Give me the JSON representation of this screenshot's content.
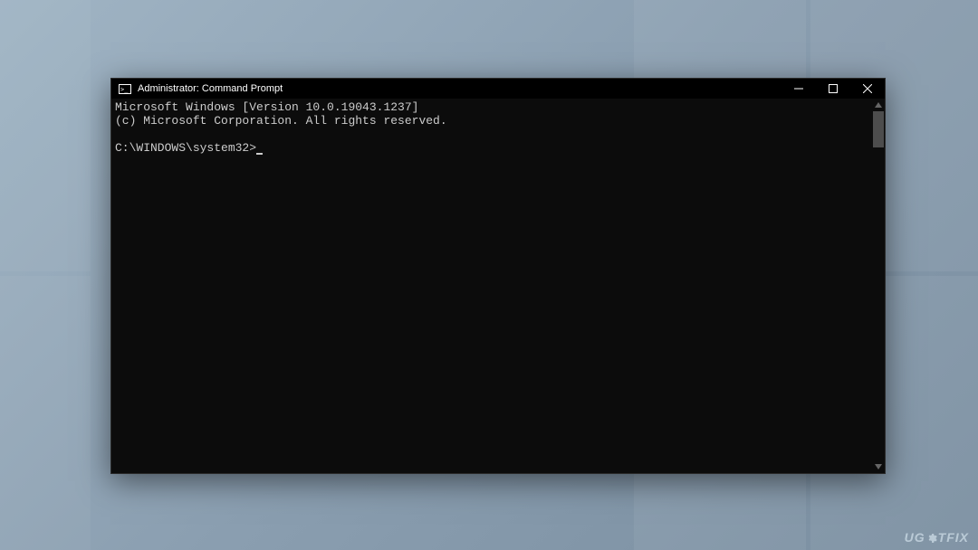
{
  "window": {
    "title": "Administrator: Command Prompt"
  },
  "terminal": {
    "line1": "Microsoft Windows [Version 10.0.19043.1237]",
    "line2": "(c) Microsoft Corporation. All rights reserved.",
    "blank": "",
    "prompt": "C:\\WINDOWS\\system32>"
  },
  "watermark": {
    "pre": "UG",
    "post": "TFIX"
  }
}
